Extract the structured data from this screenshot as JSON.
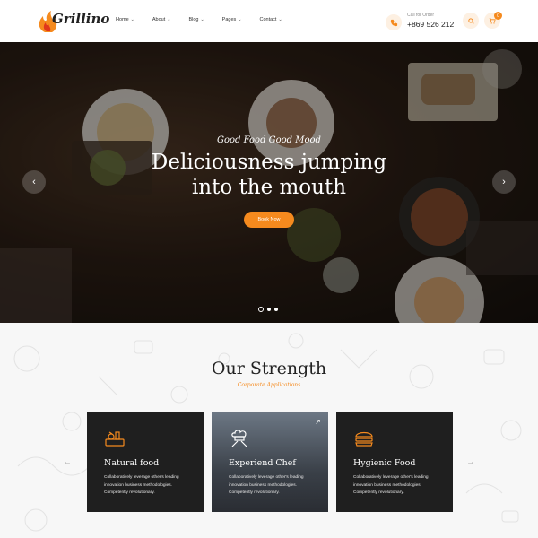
{
  "brand": {
    "name": "Grillino"
  },
  "nav": [
    {
      "label": "Home"
    },
    {
      "label": "About"
    },
    {
      "label": "Blog"
    },
    {
      "label": "Pages"
    },
    {
      "label": "Contact"
    }
  ],
  "order": {
    "label": "Call for Order",
    "phone": "+869 526 212"
  },
  "cart": {
    "count": "0"
  },
  "hero": {
    "tagline": "Good Food Good Mood",
    "title_line1": "Deliciousness jumping",
    "title_line2": "into the mouth",
    "button": "Book Now",
    "slides": 3,
    "active_slide": 1
  },
  "strength": {
    "title": "Our Strength",
    "subtitle": "Corporate Applications",
    "cards": [
      {
        "title": "Natural food",
        "text": "Collaboratively leverage other's leading innovation business methodologies. Competently revolutionary.",
        "icon": "natural-food-icon"
      },
      {
        "title": "Experiend Chef",
        "text": "Collaboratively leverage other's leading innovation business methodologies. Competently revolutionary.",
        "icon": "chef-icon"
      },
      {
        "title": "Hygienic Food",
        "text": "Collaboratively leverage other's leading innovation business methodologies. Competently revolutionary.",
        "icon": "burger-icon"
      }
    ]
  },
  "colors": {
    "accent": "#f58a1e",
    "dark": "#1f1f1f"
  }
}
